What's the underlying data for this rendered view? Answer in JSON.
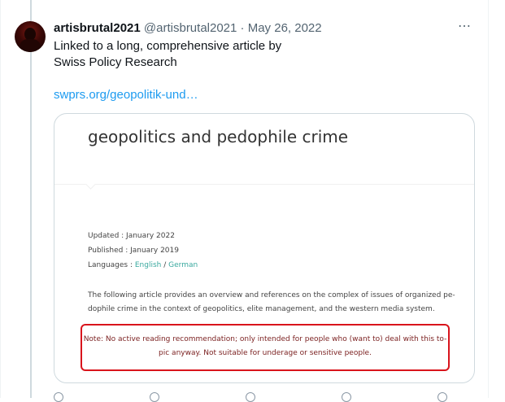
{
  "tweet": {
    "display_name": "artisbrutal2021",
    "handle": "@artisbrutal2021",
    "separator": "·",
    "date": "May 26, 2022",
    "more_icon": "⋯",
    "text_lines": [
      "Linked to a long, comprehensive article by",
      "Swiss Policy Research"
    ],
    "link_text": "swprs.org/geopolitik-und…"
  },
  "card": {
    "title": "geopolitics and pedophile crime",
    "updated": "Updated : January 2022",
    "published": "Published : January 2019",
    "languages_label": "Languages :",
    "lang_english": "English",
    "lang_sep": "/",
    "lang_german": "German",
    "intro_lines": [
      "The following article provides an overview and references on the complex of issues of organized pe-",
      "dophile crime in the context of geopolitics, elite management, and the western media system."
    ],
    "note_lines": [
      "Note: No active reading recommendation; only intended for people who (want to) deal with this to-",
      "pic anyway. Not suitable for underage or sensitive people."
    ]
  },
  "icons": {
    "avatar": "avatar-image",
    "more": "more-options-icon",
    "actions": [
      "reply-icon",
      "retweet-icon",
      "like-icon",
      "share-icon"
    ]
  },
  "colors": {
    "link": "#1d9bf0",
    "muted": "#536471",
    "note_border": "#d9141c",
    "lang_link": "#3aa99f"
  }
}
